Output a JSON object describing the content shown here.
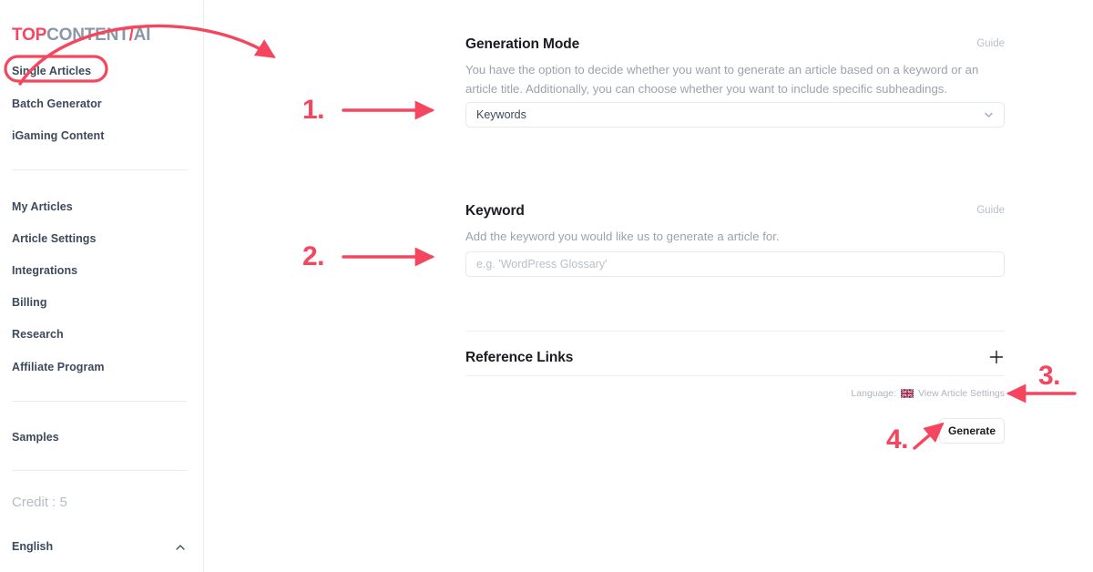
{
  "brand": {
    "logo_part1": "TOP",
    "logo_part2": "CONTENT",
    "logo_part3": "/",
    "logo_part4": "AI",
    "accent_color": "#f4475f",
    "logo_gray": "#8b97a6"
  },
  "sidebar": {
    "primary_items": [
      {
        "label": "Single Articles",
        "active": true
      },
      {
        "label": "Batch Generator",
        "active": false
      },
      {
        "label": "iGaming Content",
        "active": false
      }
    ],
    "secondary_items": [
      {
        "label": "My Articles"
      },
      {
        "label": "Article Settings"
      },
      {
        "label": "Integrations"
      },
      {
        "label": "Billing"
      },
      {
        "label": "Research"
      },
      {
        "label": "Affiliate Program"
      }
    ],
    "tertiary_items": [
      {
        "label": "Samples"
      }
    ],
    "credit_label": "Credit : 5",
    "language_label": "English",
    "language_chevron": "chevron-up-icon"
  },
  "main": {
    "generation_mode": {
      "title": "Generation Mode",
      "guide_label": "Guide",
      "description": "You have the option to decide whether you want to generate an article based on a keyword or an article title. Additionally, you can choose whether you want to include specific subheadings.",
      "selected_value": "Keywords",
      "chevron": "chevron-down-icon"
    },
    "keyword": {
      "title": "Keyword",
      "guide_label": "Guide",
      "description": "Add the keyword you would like us to generate a article for.",
      "value": "",
      "placeholder": "e.g. 'WordPress Glossary'"
    },
    "reference_links": {
      "title": "Reference Links",
      "add_icon": "plus-icon"
    },
    "footer": {
      "language_prefix": "Language:",
      "flag_icon": "uk-flag-icon",
      "view_settings_label": "View Article Settings",
      "generate_label": "Generate"
    }
  },
  "annotations": {
    "color": "#f4475f",
    "highlight_target": "Single Articles",
    "steps": [
      {
        "number": "1.",
        "points_to": "generation-mode-select",
        "direction": "right"
      },
      {
        "number": "2.",
        "points_to": "keyword-input",
        "direction": "right"
      },
      {
        "number": "3.",
        "points_to": "view-article-settings-link",
        "direction": "left"
      },
      {
        "number": "4.",
        "points_to": "generate-button",
        "direction": "up-right"
      }
    ]
  }
}
